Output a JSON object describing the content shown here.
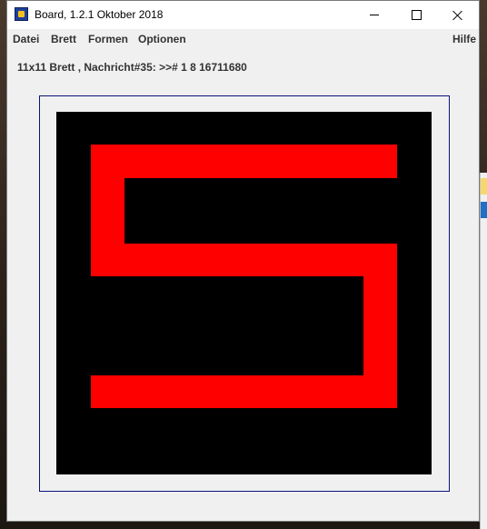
{
  "window": {
    "title": "Board, 1.2.1 Oktober 2018",
    "icon": "board-app-icon"
  },
  "menu": {
    "items": [
      "Datei",
      "Brett",
      "Formen",
      "Optionen"
    ],
    "help": "Hilfe"
  },
  "status": {
    "text": "11x11 Brett , Nachricht#35: >># 1 8 16711680"
  },
  "board": {
    "rows": 11,
    "cols": 11,
    "background_color": "#000000",
    "frame_color": "#0a1478",
    "cell_color": "#ff0000",
    "filled_cells": [
      [
        1,
        1
      ],
      [
        1,
        2
      ],
      [
        1,
        3
      ],
      [
        1,
        4
      ],
      [
        1,
        5
      ],
      [
        1,
        6
      ],
      [
        1,
        7
      ],
      [
        1,
        8
      ],
      [
        1,
        9
      ],
      [
        2,
        1
      ],
      [
        3,
        1
      ],
      [
        4,
        1
      ],
      [
        4,
        2
      ],
      [
        4,
        3
      ],
      [
        4,
        4
      ],
      [
        4,
        5
      ],
      [
        4,
        6
      ],
      [
        4,
        7
      ],
      [
        4,
        8
      ],
      [
        4,
        9
      ],
      [
        5,
        9
      ],
      [
        6,
        9
      ],
      [
        7,
        9
      ],
      [
        8,
        1
      ],
      [
        8,
        2
      ],
      [
        8,
        3
      ],
      [
        8,
        4
      ],
      [
        8,
        5
      ],
      [
        8,
        6
      ],
      [
        8,
        7
      ],
      [
        8,
        8
      ],
      [
        8,
        9
      ]
    ]
  }
}
